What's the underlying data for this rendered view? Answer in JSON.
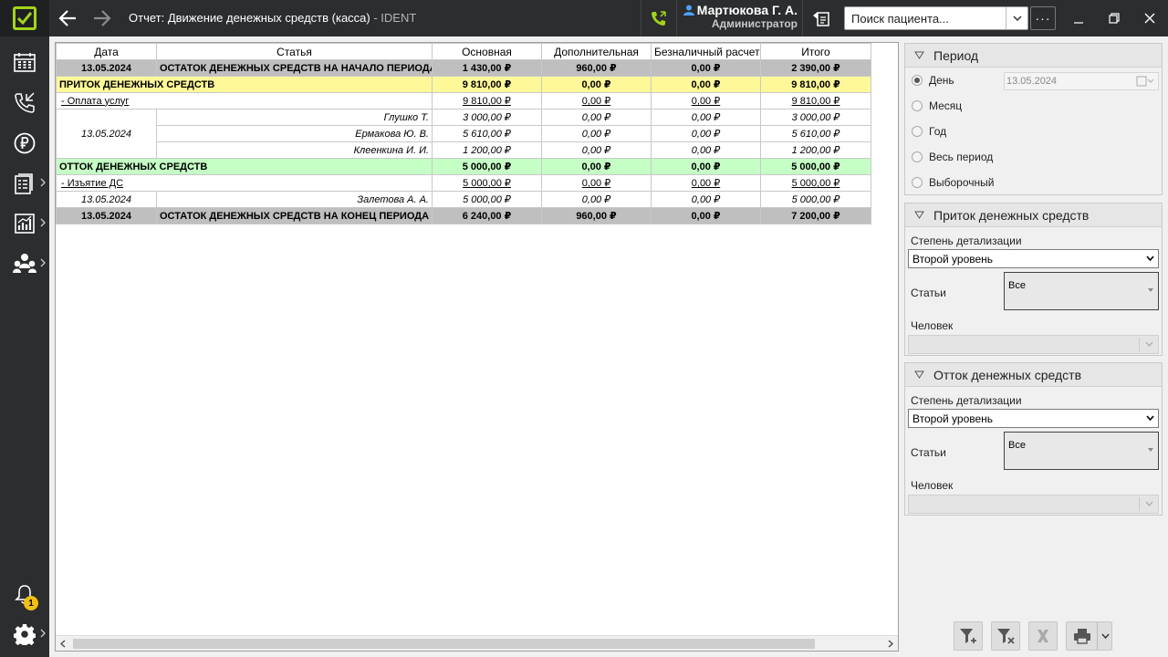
{
  "window": {
    "title": "Отчет: Движение денежных средств (касса)",
    "app_suffix": " - IDENT",
    "user_name": "Мартюкова Г. А.",
    "user_role": "Администратор",
    "search_placeholder": "Поиск пациента...",
    "more_label": "···",
    "notifications_count": "1"
  },
  "sidebar": {
    "items": [
      {
        "icon": "schedule-icon"
      },
      {
        "icon": "phone-calls-icon"
      },
      {
        "icon": "ruble-icon"
      },
      {
        "icon": "documents-icon"
      },
      {
        "icon": "reports-icon"
      },
      {
        "icon": "people-icon"
      }
    ]
  },
  "report": {
    "columns": [
      "Дата",
      "Статья",
      "Основная",
      "Дополнительная",
      "Безналичный расчет",
      "Итого"
    ],
    "opening": {
      "date": "13.05.2024",
      "label": "ОСТАТОК ДЕНЕЖНЫХ СРЕДСТВ НА НАЧАЛО ПЕРИОДА",
      "main": "1 430,00 ₽",
      "extra": "960,00 ₽",
      "cashless": "0,00 ₽",
      "total": "2 390,00 ₽"
    },
    "inflow": {
      "label": "ПРИТОК ДЕНЕЖНЫХ СРЕДСТВ",
      "main": "9 810,00 ₽",
      "extra": "0,00 ₽",
      "cashless": "0,00 ₽",
      "total": "9 810,00 ₽"
    },
    "inflow_group": {
      "label": "- Оплата услуг",
      "main": "9 810,00 ₽",
      "extra": "0,00 ₽",
      "cashless": "0,00 ₽",
      "total": "9 810,00 ₽"
    },
    "inflow_date": "13.05.2024",
    "inflow_rows": [
      {
        "name": "Глушко Т.",
        "main": "3 000,00 ₽",
        "extra": "0,00 ₽",
        "cashless": "0,00 ₽",
        "total": "3 000,00 ₽"
      },
      {
        "name": "Ермакова Ю. В.",
        "main": "5 610,00 ₽",
        "extra": "0,00 ₽",
        "cashless": "0,00 ₽",
        "total": "5 610,00 ₽"
      },
      {
        "name": "Клеенкина И. И.",
        "main": "1 200,00 ₽",
        "extra": "0,00 ₽",
        "cashless": "0,00 ₽",
        "total": "1 200,00 ₽"
      }
    ],
    "outflow": {
      "label": "ОТТОК ДЕНЕЖНЫХ СРЕДСТВ",
      "main": "5 000,00 ₽",
      "extra": "0,00 ₽",
      "cashless": "0,00 ₽",
      "total": "5 000,00 ₽"
    },
    "outflow_group": {
      "label": "- Изъятие ДС",
      "main": "5 000,00 ₽",
      "extra": "0,00 ₽",
      "cashless": "0,00 ₽",
      "total": "5 000,00 ₽"
    },
    "outflow_row": {
      "date": "13.05.2024",
      "name": "Залетова А. А.",
      "main": "5 000,00 ₽",
      "extra": "0,00 ₽",
      "cashless": "0,00 ₽",
      "total": "5 000,00 ₽"
    },
    "closing": {
      "date": "13.05.2024",
      "label": "ОСТАТОК ДЕНЕЖНЫХ СРЕДСТВ НА КОНЕЦ ПЕРИОДА",
      "main": "6 240,00 ₽",
      "extra": "960,00 ₽",
      "cashless": "0,00 ₽",
      "total": "7 200,00 ₽"
    }
  },
  "period_panel": {
    "title": "Период",
    "options": [
      "День",
      "Месяц",
      "Год",
      "Весь период",
      "Выборочный"
    ],
    "selected": "День",
    "date_value": "13.05.2024"
  },
  "inflow_panel": {
    "title": "Приток денежных средств",
    "detail_label": "Степень детализации",
    "detail_value": "Второй уровень",
    "articles_label": "Статьи",
    "articles_value": "Все",
    "person_label": "Человек"
  },
  "outflow_panel": {
    "title": "Отток денежных средств",
    "detail_label": "Степень детализации",
    "detail_value": "Второй уровень",
    "articles_label": "Статьи",
    "articles_value": "Все",
    "person_label": "Человек"
  }
}
